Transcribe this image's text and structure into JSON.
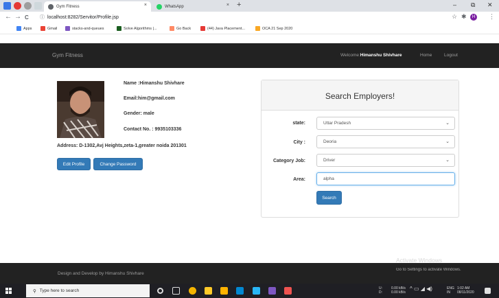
{
  "browser": {
    "tabs": [
      {
        "label": "Gym Fitness",
        "close": "×"
      },
      {
        "label": "WhatsApp",
        "close": "×"
      }
    ],
    "new_tab": "+",
    "window_controls": {
      "minimize": "–",
      "maximize": "⧉",
      "close": "✕"
    },
    "nav": {
      "back": "←",
      "forward": "→",
      "reload": "C"
    },
    "url": "localhost:8282/Servitor/Profile.jsp",
    "toolbar": {
      "star": "☆",
      "extension": "✱",
      "profile_initial": "H",
      "menu": "⋮"
    }
  },
  "bookmarks": [
    {
      "label": "Apps"
    },
    {
      "label": "Gmail"
    },
    {
      "label": "stacks-and-queues"
    },
    {
      "label": "Solve Algorithms |..."
    },
    {
      "label": "Go Back"
    },
    {
      "label": "(44) Java Placement..."
    },
    {
      "label": "OCA 21 Sep 2020"
    }
  ],
  "navbar": {
    "brand": "Gym Fitness",
    "welcome_prefix": "Welcome:",
    "welcome_user": "Himanshu Shivhare",
    "home": "Home",
    "logout": "Logout"
  },
  "profile": {
    "name": "Name :Himanshu Shivhare",
    "email": "Email:him@gmail.com",
    "gender": "Gender: male",
    "contact": "Contact No. : 9935103336",
    "address": "Address: D-1302,Avj Heights,zeta-1,greater noida 201301",
    "edit_button": "Edit Profile",
    "password_button": "Change Password"
  },
  "search_panel": {
    "title": "Search Employers!",
    "state_label": "state:",
    "state_value": "Uttar Pradesh",
    "city_label": "City :",
    "city_value": "Deoria",
    "category_label": "Category Job:",
    "category_value": "Driver",
    "area_label": "Area:",
    "area_value": "alpha",
    "search_button": "Search"
  },
  "footer": {
    "text": "Design and Develop by Himanshu Shivhare"
  },
  "watermark": {
    "title": "Activate Windows",
    "subtitle": "Go to Settings to activate Windows."
  },
  "taskbar": {
    "search_placeholder": "Type here to search",
    "net_line1": "0.00 kB/s",
    "net_line2": "0.00 kB/s",
    "lang_line1": "ENG",
    "lang_line2": "IN",
    "time": "1:02 AM",
    "date": "08/11/2020"
  },
  "colors": {
    "primary": "#337ab7",
    "navbar": "#222222"
  }
}
